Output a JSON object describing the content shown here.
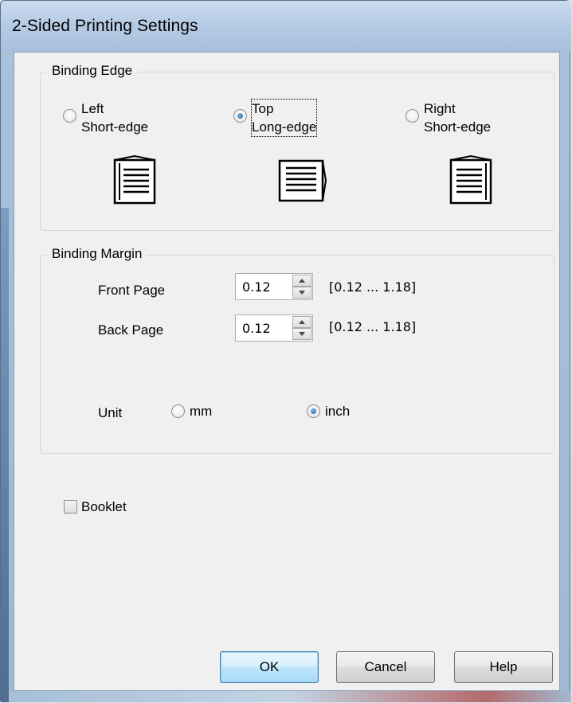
{
  "window": {
    "title": "2-Sided Printing Settings"
  },
  "binding_edge": {
    "group_title": "Binding Edge",
    "options": [
      {
        "line1": "Left",
        "line2": "Short-edge",
        "checked": false,
        "icon": "left-binding-page-icon"
      },
      {
        "line1": "Top",
        "line2": "Long-edge",
        "checked": true,
        "icon": "top-binding-page-icon"
      },
      {
        "line1": "Right",
        "line2": "Short-edge",
        "checked": false,
        "icon": "right-binding-page-icon"
      }
    ]
  },
  "binding_margin": {
    "group_title": "Binding Margin",
    "front_page": {
      "label": "Front Page",
      "value": "0.12",
      "range": "[0.12 ... 1.18]"
    },
    "back_page": {
      "label": "Back Page",
      "value": "0.12",
      "range": "[0.12 ... 1.18]"
    },
    "unit": {
      "label": "Unit",
      "options": [
        {
          "label": "mm",
          "checked": false
        },
        {
          "label": "inch",
          "checked": true
        }
      ]
    }
  },
  "booklet": {
    "label": "Booklet",
    "checked": false
  },
  "buttons": {
    "ok": "OK",
    "cancel": "Cancel",
    "help": "Help"
  }
}
